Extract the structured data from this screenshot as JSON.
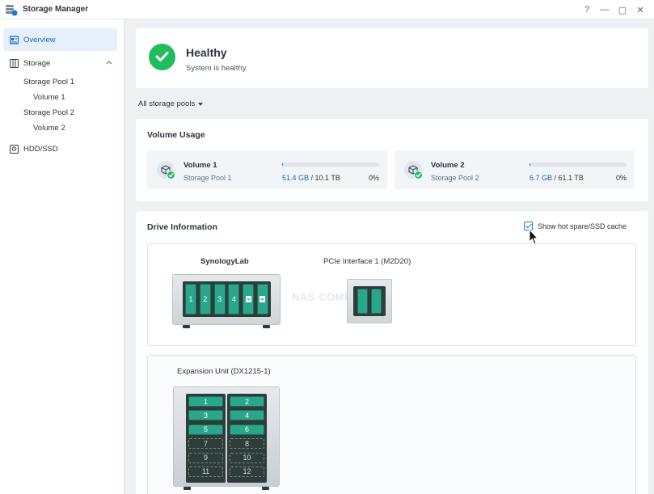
{
  "window": {
    "title": "Storage Manager",
    "controls": {
      "help": "?",
      "minimize": "—",
      "maximize": "▢",
      "close": "✕"
    }
  },
  "sidebar": {
    "overview": "Overview",
    "storage": "Storage",
    "storage_pool_1": "Storage Pool 1",
    "volume_1": "Volume 1",
    "storage_pool_2": "Storage Pool 2",
    "volume_2": "Volume 2",
    "hdd_ssd": "HDD/SSD"
  },
  "health": {
    "title": "Healthy",
    "subtitle": "System is healthy.",
    "status_color": "#1fbd5e"
  },
  "filter": {
    "label": "All storage pools"
  },
  "volume_usage": {
    "title": "Volume Usage",
    "volumes": [
      {
        "name": "Volume 1",
        "pool": "Storage Pool 1",
        "used": "51.4 GB",
        "total": "/ 10.1 TB",
        "percent": "0%",
        "fraction": 0.005
      },
      {
        "name": "Volume 2",
        "pool": "Storage Pool 2",
        "used": "6.7 GB",
        "total": "/ 61.1 TB",
        "percent": "0%",
        "fraction": 0.001
      }
    ]
  },
  "drive_info": {
    "title": "Drive Information",
    "hot_spare_label": "Show hot spare/SSD cache",
    "hot_spare_checked": true,
    "watermark": "NAS COMPARES",
    "host": {
      "name": "SynologyLab",
      "bays": [
        "1",
        "2",
        "3",
        "4"
      ]
    },
    "pcie": {
      "name": "PCIe Interface 1 (M2D20)"
    },
    "expansion": {
      "name": "Expansion Unit (DX1215-1)",
      "left_bays": [
        {
          "label": "1",
          "populated": true
        },
        {
          "label": "3",
          "populated": true
        },
        {
          "label": "5",
          "populated": true
        },
        {
          "label": "7",
          "populated": false
        },
        {
          "label": "9",
          "populated": false
        },
        {
          "label": "11",
          "populated": false
        }
      ],
      "right_bays": [
        {
          "label": "2",
          "populated": true
        },
        {
          "label": "4",
          "populated": true
        },
        {
          "label": "6",
          "populated": true
        },
        {
          "label": "8",
          "populated": false
        },
        {
          "label": "10",
          "populated": false
        },
        {
          "label": "12",
          "populated": false
        }
      ]
    }
  },
  "colors": {
    "accent": "#1a62c0",
    "drive_green": "#2aa78a",
    "enclosure_dark": "#2f3d3a"
  }
}
